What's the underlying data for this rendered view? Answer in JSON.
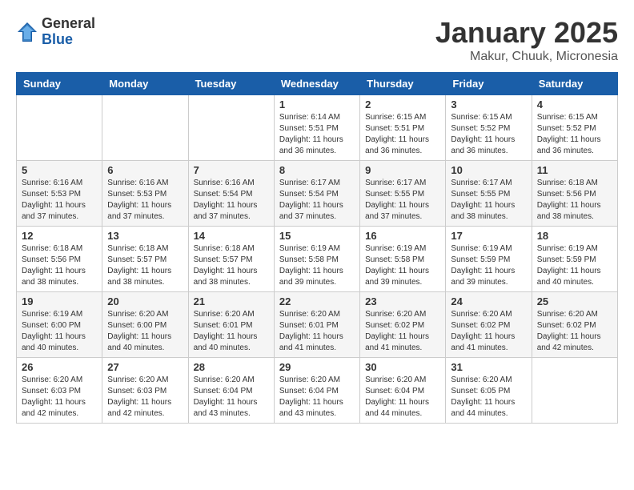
{
  "header": {
    "logo": {
      "general": "General",
      "blue": "Blue"
    },
    "title": "January 2025",
    "subtitle": "Makur, Chuuk, Micronesia"
  },
  "weekdays": [
    "Sunday",
    "Monday",
    "Tuesday",
    "Wednesday",
    "Thursday",
    "Friday",
    "Saturday"
  ],
  "weeks": [
    [
      {
        "day": "",
        "info": ""
      },
      {
        "day": "",
        "info": ""
      },
      {
        "day": "",
        "info": ""
      },
      {
        "day": "1",
        "info": "Sunrise: 6:14 AM\nSunset: 5:51 PM\nDaylight: 11 hours and 36 minutes."
      },
      {
        "day": "2",
        "info": "Sunrise: 6:15 AM\nSunset: 5:51 PM\nDaylight: 11 hours and 36 minutes."
      },
      {
        "day": "3",
        "info": "Sunrise: 6:15 AM\nSunset: 5:52 PM\nDaylight: 11 hours and 36 minutes."
      },
      {
        "day": "4",
        "info": "Sunrise: 6:15 AM\nSunset: 5:52 PM\nDaylight: 11 hours and 36 minutes."
      }
    ],
    [
      {
        "day": "5",
        "info": "Sunrise: 6:16 AM\nSunset: 5:53 PM\nDaylight: 11 hours and 37 minutes."
      },
      {
        "day": "6",
        "info": "Sunrise: 6:16 AM\nSunset: 5:53 PM\nDaylight: 11 hours and 37 minutes."
      },
      {
        "day": "7",
        "info": "Sunrise: 6:16 AM\nSunset: 5:54 PM\nDaylight: 11 hours and 37 minutes."
      },
      {
        "day": "8",
        "info": "Sunrise: 6:17 AM\nSunset: 5:54 PM\nDaylight: 11 hours and 37 minutes."
      },
      {
        "day": "9",
        "info": "Sunrise: 6:17 AM\nSunset: 5:55 PM\nDaylight: 11 hours and 37 minutes."
      },
      {
        "day": "10",
        "info": "Sunrise: 6:17 AM\nSunset: 5:55 PM\nDaylight: 11 hours and 38 minutes."
      },
      {
        "day": "11",
        "info": "Sunrise: 6:18 AM\nSunset: 5:56 PM\nDaylight: 11 hours and 38 minutes."
      }
    ],
    [
      {
        "day": "12",
        "info": "Sunrise: 6:18 AM\nSunset: 5:56 PM\nDaylight: 11 hours and 38 minutes."
      },
      {
        "day": "13",
        "info": "Sunrise: 6:18 AM\nSunset: 5:57 PM\nDaylight: 11 hours and 38 minutes."
      },
      {
        "day": "14",
        "info": "Sunrise: 6:18 AM\nSunset: 5:57 PM\nDaylight: 11 hours and 38 minutes."
      },
      {
        "day": "15",
        "info": "Sunrise: 6:19 AM\nSunset: 5:58 PM\nDaylight: 11 hours and 39 minutes."
      },
      {
        "day": "16",
        "info": "Sunrise: 6:19 AM\nSunset: 5:58 PM\nDaylight: 11 hours and 39 minutes."
      },
      {
        "day": "17",
        "info": "Sunrise: 6:19 AM\nSunset: 5:59 PM\nDaylight: 11 hours and 39 minutes."
      },
      {
        "day": "18",
        "info": "Sunrise: 6:19 AM\nSunset: 5:59 PM\nDaylight: 11 hours and 40 minutes."
      }
    ],
    [
      {
        "day": "19",
        "info": "Sunrise: 6:19 AM\nSunset: 6:00 PM\nDaylight: 11 hours and 40 minutes."
      },
      {
        "day": "20",
        "info": "Sunrise: 6:20 AM\nSunset: 6:00 PM\nDaylight: 11 hours and 40 minutes."
      },
      {
        "day": "21",
        "info": "Sunrise: 6:20 AM\nSunset: 6:01 PM\nDaylight: 11 hours and 40 minutes."
      },
      {
        "day": "22",
        "info": "Sunrise: 6:20 AM\nSunset: 6:01 PM\nDaylight: 11 hours and 41 minutes."
      },
      {
        "day": "23",
        "info": "Sunrise: 6:20 AM\nSunset: 6:02 PM\nDaylight: 11 hours and 41 minutes."
      },
      {
        "day": "24",
        "info": "Sunrise: 6:20 AM\nSunset: 6:02 PM\nDaylight: 11 hours and 41 minutes."
      },
      {
        "day": "25",
        "info": "Sunrise: 6:20 AM\nSunset: 6:02 PM\nDaylight: 11 hours and 42 minutes."
      }
    ],
    [
      {
        "day": "26",
        "info": "Sunrise: 6:20 AM\nSunset: 6:03 PM\nDaylight: 11 hours and 42 minutes."
      },
      {
        "day": "27",
        "info": "Sunrise: 6:20 AM\nSunset: 6:03 PM\nDaylight: 11 hours and 42 minutes."
      },
      {
        "day": "28",
        "info": "Sunrise: 6:20 AM\nSunset: 6:04 PM\nDaylight: 11 hours and 43 minutes."
      },
      {
        "day": "29",
        "info": "Sunrise: 6:20 AM\nSunset: 6:04 PM\nDaylight: 11 hours and 43 minutes."
      },
      {
        "day": "30",
        "info": "Sunrise: 6:20 AM\nSunset: 6:04 PM\nDaylight: 11 hours and 44 minutes."
      },
      {
        "day": "31",
        "info": "Sunrise: 6:20 AM\nSunset: 6:05 PM\nDaylight: 11 hours and 44 minutes."
      },
      {
        "day": "",
        "info": ""
      }
    ]
  ]
}
